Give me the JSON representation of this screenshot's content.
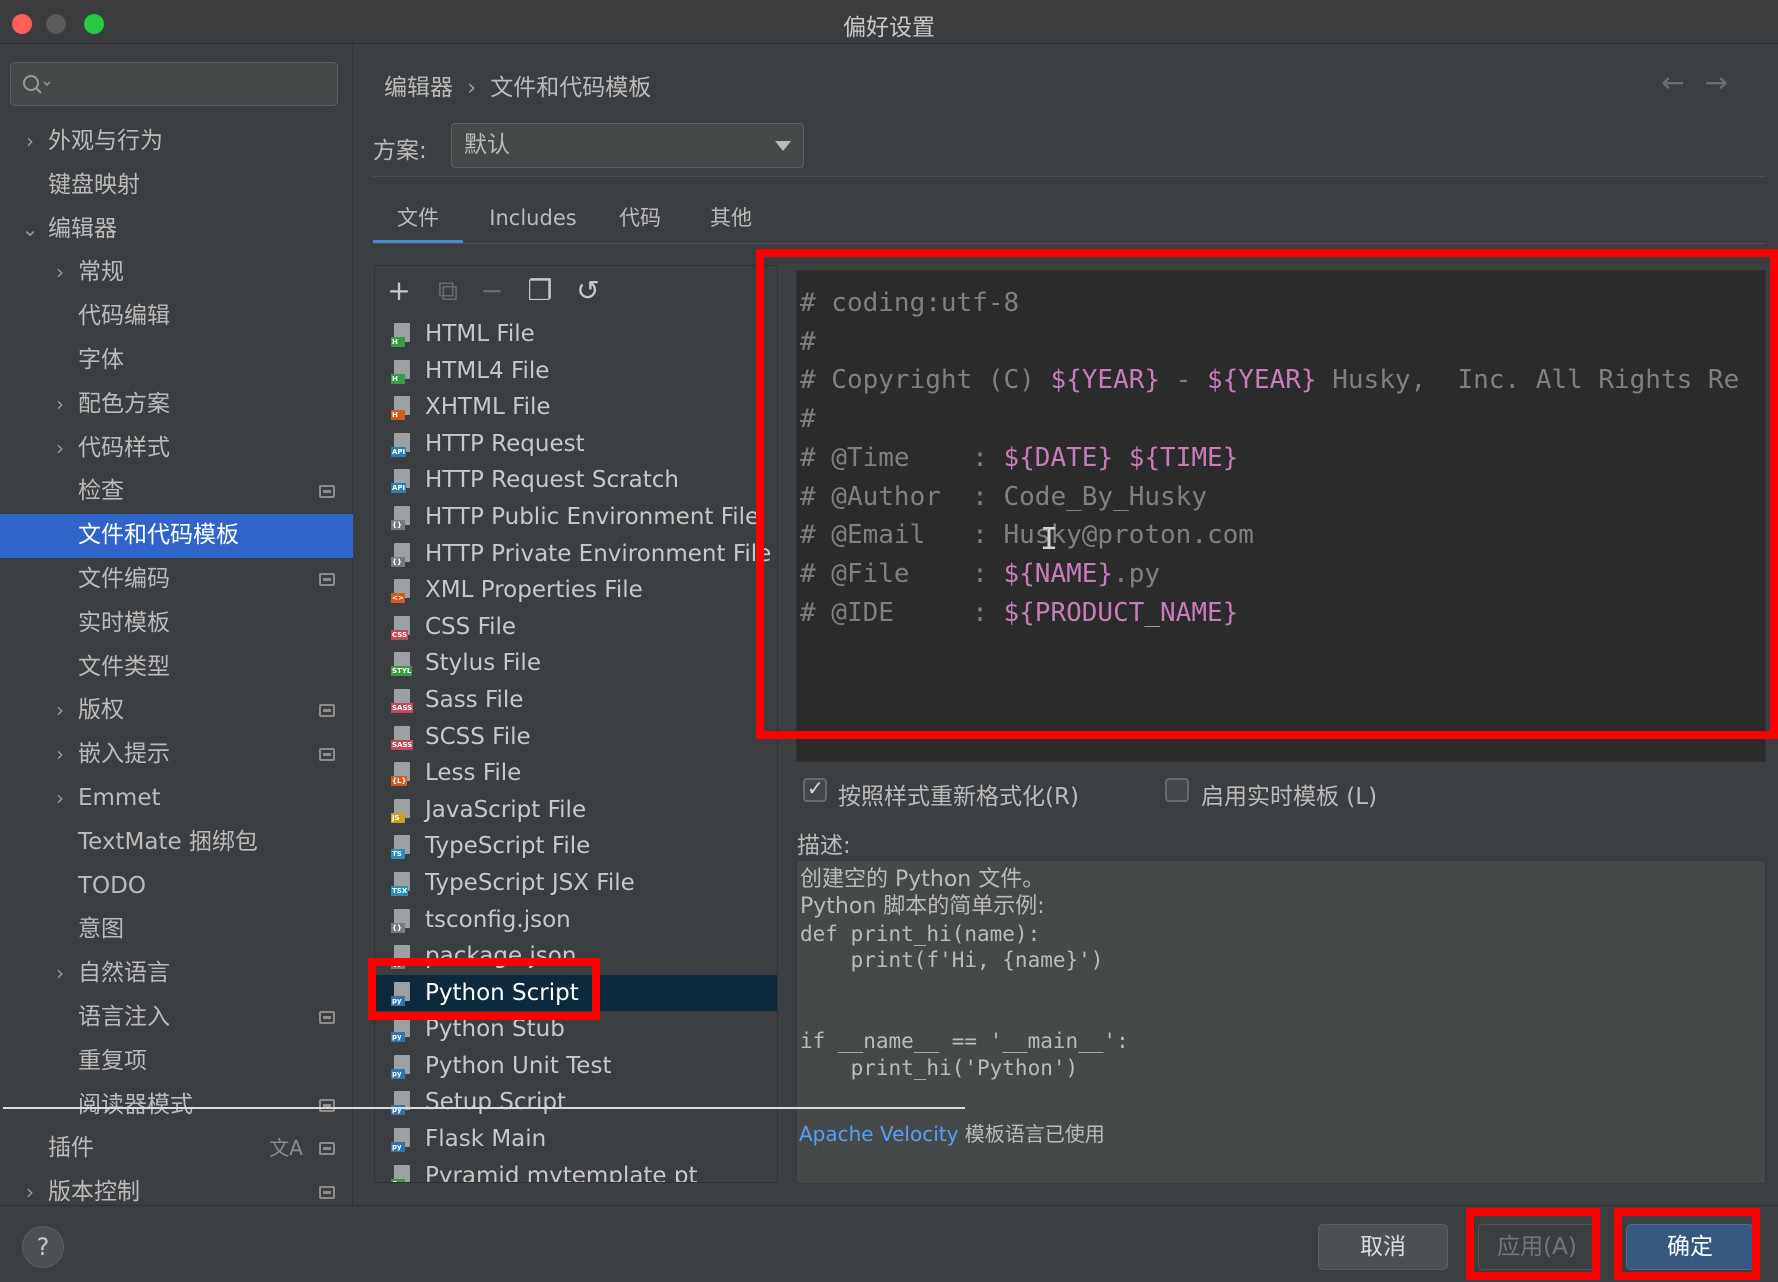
{
  "window": {
    "title": "偏好设置"
  },
  "search": {
    "placeholder": ""
  },
  "sidebar": {
    "items": [
      {
        "label": "外观与行为",
        "arrow": "›",
        "level": 0
      },
      {
        "label": "键盘映射",
        "level": 0
      },
      {
        "label": "编辑器",
        "arrow": "⌄",
        "level": 0
      },
      {
        "label": "常规",
        "arrow": "›",
        "level": 1
      },
      {
        "label": "代码编辑",
        "level": 1
      },
      {
        "label": "字体",
        "level": 1
      },
      {
        "label": "配色方案",
        "arrow": "›",
        "level": 1
      },
      {
        "label": "代码样式",
        "arrow": "›",
        "level": 1
      },
      {
        "label": "检查",
        "level": 1,
        "scope": true
      },
      {
        "label": "文件和代码模板",
        "level": 1,
        "selected": true
      },
      {
        "label": "文件编码",
        "level": 1,
        "scope": true
      },
      {
        "label": "实时模板",
        "level": 1
      },
      {
        "label": "文件类型",
        "level": 1
      },
      {
        "label": "版权",
        "arrow": "›",
        "level": 1,
        "scope": true
      },
      {
        "label": "嵌入提示",
        "arrow": "›",
        "level": 1,
        "scope": true
      },
      {
        "label": "Emmet",
        "arrow": "›",
        "level": 1
      },
      {
        "label": "TextMate 捆绑包",
        "level": 1
      },
      {
        "label": "TODO",
        "level": 1
      },
      {
        "label": "意图",
        "level": 1
      },
      {
        "label": "自然语言",
        "arrow": "›",
        "level": 1
      },
      {
        "label": "语言注入",
        "level": 1,
        "scope": true
      },
      {
        "label": "重复项",
        "level": 1
      },
      {
        "label": "阅读器模式",
        "level": 1,
        "scope": true
      },
      {
        "label": "插件",
        "level": 0,
        "scope": true,
        "translate": true
      },
      {
        "label": "版本控制",
        "arrow": "›",
        "level": 0,
        "scope": true
      }
    ]
  },
  "breadcrumb": {
    "parent": "编辑器",
    "separator": "›",
    "current": "文件和代码模板"
  },
  "nav": {
    "back": "←",
    "forward": "→"
  },
  "scheme": {
    "label": "方案:",
    "value": "默认"
  },
  "tabs": [
    {
      "label": "文件",
      "active": true
    },
    {
      "label": "Includes"
    },
    {
      "label": "代码"
    },
    {
      "label": "其他"
    }
  ],
  "toolbar": {
    "add": "+",
    "copy_add": "⧉",
    "remove": "−",
    "duplicate": "❐",
    "reset": "↺"
  },
  "templates": [
    {
      "name": "HTML File",
      "tag": "H",
      "color": "#3b9a48"
    },
    {
      "name": "HTML4 File",
      "tag": "H",
      "color": "#3b9a48"
    },
    {
      "name": "XHTML File",
      "tag": "H",
      "color": "#d35a1d"
    },
    {
      "name": "HTTP Request",
      "tag": "API",
      "color": "#2a7fb0"
    },
    {
      "name": "HTTP Request Scratch",
      "tag": "API",
      "color": "#2a7fb0"
    },
    {
      "name": "HTTP Public Environment File",
      "tag": "{}",
      "color": "#7a7a7a"
    },
    {
      "name": "HTTP Private Environment File",
      "tag": "{}",
      "color": "#7a7a7a"
    },
    {
      "name": "XML Properties File",
      "tag": "<>",
      "color": "#d35a1d"
    },
    {
      "name": "CSS File",
      "tag": "CSS",
      "color": "#c0495e"
    },
    {
      "name": "Stylus File",
      "tag": "STYL",
      "color": "#3b9a48"
    },
    {
      "name": "Sass File",
      "tag": "SASS",
      "color": "#c0495e"
    },
    {
      "name": "SCSS File",
      "tag": "SASS",
      "color": "#c0495e"
    },
    {
      "name": "Less File",
      "tag": "{L}",
      "color": "#d35a1d"
    },
    {
      "name": "JavaScript File",
      "tag": "JS",
      "color": "#c9a21d"
    },
    {
      "name": "TypeScript File",
      "tag": "TS",
      "color": "#2a8fb6"
    },
    {
      "name": "TypeScript JSX File",
      "tag": "TSX",
      "color": "#2a8fb6"
    },
    {
      "name": "tsconfig.json",
      "tag": "{}",
      "color": "#7a7a7a"
    },
    {
      "name": "package.json",
      "tag": "{}",
      "color": "#7a7a7a"
    },
    {
      "name": "Python Script",
      "tag": "py",
      "color": "#3572a5",
      "selected": true
    },
    {
      "name": "Python Stub",
      "tag": "py",
      "color": "#3572a5"
    },
    {
      "name": "Python Unit Test",
      "tag": "py",
      "color": "#3572a5"
    },
    {
      "name": "Setup Script",
      "tag": "py",
      "color": "#3572a5"
    },
    {
      "name": "Flask Main",
      "tag": "py",
      "color": "#3572a5"
    },
    {
      "name": "Pyramid mytemplate pt",
      "tag": "C",
      "color": "#3b9a48"
    }
  ],
  "editor": {
    "lines": [
      [
        {
          "t": "# coding:utf-8",
          "c": "txt"
        }
      ],
      [
        {
          "t": "#",
          "c": "txt"
        }
      ],
      [
        {
          "t": "# Copyright (C) ",
          "c": "txt"
        },
        {
          "t": "${YEAR}",
          "c": "var"
        },
        {
          "t": " - ",
          "c": "txt"
        },
        {
          "t": "${YEAR}",
          "c": "var"
        },
        {
          "t": " Husky,  Inc. All Rights Re",
          "c": "txt"
        }
      ],
      [
        {
          "t": "#",
          "c": "txt"
        }
      ],
      [
        {
          "t": "# @Time    : ",
          "c": "txt"
        },
        {
          "t": "${DATE}",
          "c": "var"
        },
        {
          "t": " ",
          "c": "txt"
        },
        {
          "t": "${TIME}",
          "c": "var"
        }
      ],
      [
        {
          "t": "# @Author  : Code_By_Husky",
          "c": "txt"
        }
      ],
      [
        {
          "t": "# @Email   : Husky@proton.com",
          "c": "txt"
        }
      ],
      [
        {
          "t": "# @File    : ",
          "c": "txt"
        },
        {
          "t": "${NAME}",
          "c": "var"
        },
        {
          "t": ".py",
          "c": "txt"
        }
      ],
      [
        {
          "t": "# @IDE     : ",
          "c": "txt"
        },
        {
          "t": "${PRODUCT_NAME}",
          "c": "var"
        }
      ]
    ]
  },
  "options": {
    "reformat": {
      "label": "按照样式重新格式化(R)",
      "checked": true
    },
    "live_template": {
      "label": "启用实时模板 (L)",
      "checked": false
    }
  },
  "description": {
    "label": "描述:",
    "lines": [
      {
        "text": "创建空的 Python 文件。",
        "mono": false
      },
      {
        "text": "Python 脚本的简单示例:",
        "mono": false
      },
      {
        "text": "def print_hi(name):",
        "mono": true
      },
      {
        "text": "    print(f'Hi, {name}')",
        "mono": true
      },
      {
        "text": "",
        "mono": true
      },
      {
        "text": "",
        "mono": true
      },
      {
        "text": "if __name__ == '__main__':",
        "mono": true
      },
      {
        "text": "    print_hi('Python')",
        "mono": true
      }
    ],
    "velocity_link": "Apache Velocity",
    "velocity_text": " 模板语言已使用"
  },
  "buttons": {
    "help": "?",
    "cancel": "取消",
    "apply": "应用(A)",
    "ok": "确定"
  }
}
